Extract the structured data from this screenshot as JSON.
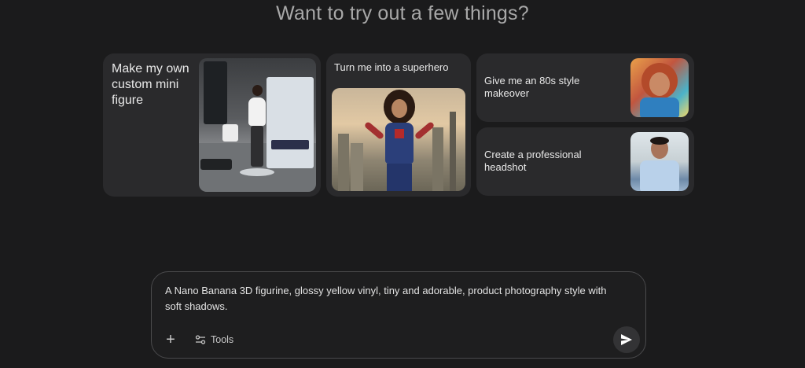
{
  "heading": "Want to try out a few things?",
  "suggestions": [
    {
      "label": "Make my own custom mini figure"
    },
    {
      "label": "Turn me into a superhero"
    },
    {
      "label": "Give me an 80s style makeover"
    },
    {
      "label": "Create a professional headshot"
    }
  ],
  "prompt": {
    "text": "A Nano Banana 3D figurine, glossy yellow vinyl, tiny and adorable, product photography style with soft shadows."
  },
  "toolbar": {
    "add_icon": "plus-icon",
    "tools_icon": "tune-icon",
    "tools_label": "Tools",
    "send_icon": "send-icon"
  }
}
